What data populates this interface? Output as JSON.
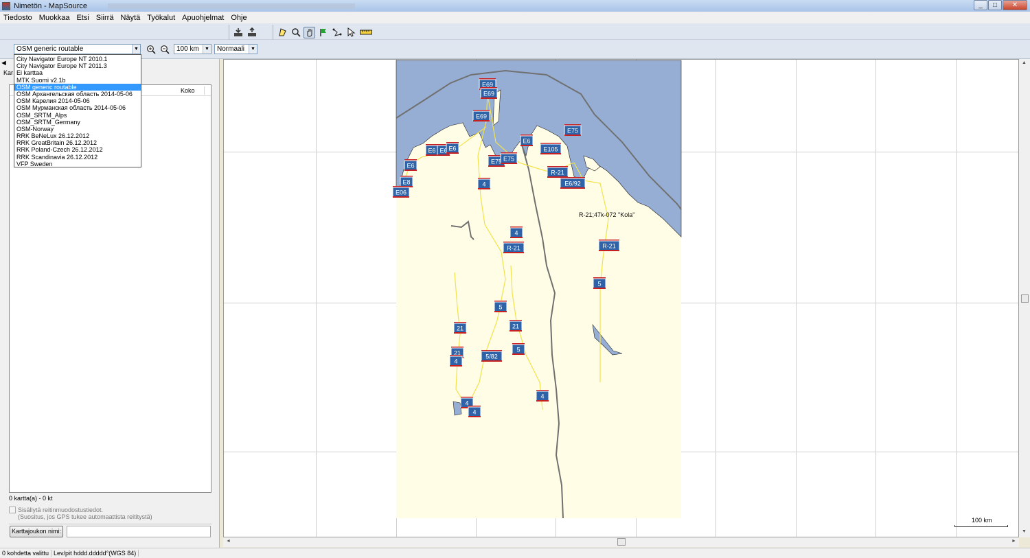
{
  "window": {
    "title": "Nimetön - MapSource",
    "minimize": "_",
    "maximize": "□",
    "close": "✕"
  },
  "menu": [
    "Tiedosto",
    "Muokkaa",
    "Etsi",
    "Siirrä",
    "Näytä",
    "Työkalut",
    "Apuohjelmat",
    "Ohje"
  ],
  "toolbar": {
    "map_product": "OSM generic routable",
    "zoom_level": "100 km",
    "detail_level": "Normaali",
    "map_products": [
      "City Navigator Europe NT 2010.1",
      "City Navigator Europe NT 2011.3",
      "Ei karttaa",
      "MTK Suomi v2.1b",
      "OSM generic routable",
      "OSM Архангельская область 2014-05-06",
      "OSM Карелия 2014-05-06",
      "OSM Мурманская область 2014-05-06",
      "OSM_SRTM_Alps",
      "OSM_SRTM_Germany",
      "OSM-Norway",
      "RRK BeNeLux 26.12.2012",
      "RRK GreatBritain 26.12.2012",
      "RRK Poland-Czech 26.12.2012",
      "RRK Scandinavia 26.12.2012",
      "VFP Sweden"
    ],
    "selected_index": 4
  },
  "left_panel": {
    "tab_stub": "Kar",
    "column_size": "Koko",
    "summary": "0 kartta(a) - 0 kt",
    "checkbox_line1": "Sisällytä reitinmuodostustiedot.",
    "checkbox_line2": "(Suositus, jos GPS tukee automaattista reititystä)",
    "mapset_button": "Karttajoukon nimi:",
    "mapset_value": ""
  },
  "map": {
    "colors": {
      "sea": "#96aed4",
      "land": "#fffde6",
      "road": "#f2e24a",
      "border": "#707070"
    },
    "labels": [
      {
        "text": "E69"
      },
      {
        "text": "E69"
      },
      {
        "text": "E69"
      },
      {
        "text": "E75"
      },
      {
        "text": "E6"
      },
      {
        "text": "E6"
      },
      {
        "text": "E6"
      },
      {
        "text": "E6"
      },
      {
        "text": "E6"
      },
      {
        "text": "E8"
      },
      {
        "text": "E06"
      },
      {
        "text": "E75"
      },
      {
        "text": "E75"
      },
      {
        "text": "E105"
      },
      {
        "text": "R-21"
      },
      {
        "text": "E6/92"
      },
      {
        "text": "4"
      },
      {
        "text": "4"
      },
      {
        "text": "R-21"
      },
      {
        "text": "R-21"
      },
      {
        "text": "5"
      },
      {
        "text": "5"
      },
      {
        "text": "21"
      },
      {
        "text": "21"
      },
      {
        "text": "21"
      },
      {
        "text": "4"
      },
      {
        "text": "5/82"
      },
      {
        "text": "5"
      },
      {
        "text": "4"
      },
      {
        "text": "4"
      },
      {
        "text": "4"
      }
    ],
    "road_name": "R-21;47k-072 \"Kola\"",
    "scale": "100 km"
  },
  "status": {
    "selection": "0 kohdetta valittu",
    "format": "Lev/pit hddd.ddddd°(WGS 84)"
  }
}
